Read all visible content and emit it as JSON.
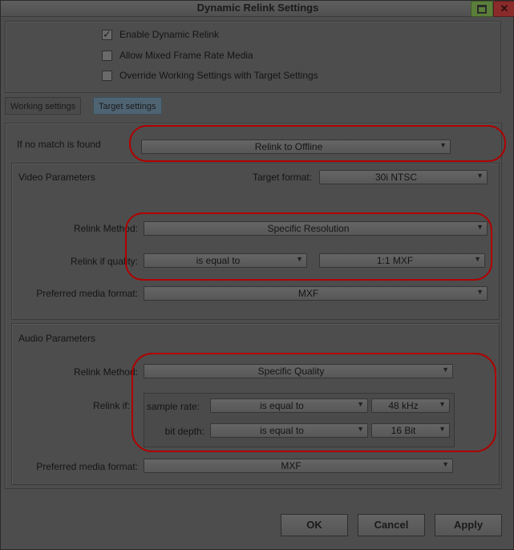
{
  "window": {
    "title": "Dynamic Relink Settings"
  },
  "options": {
    "enable_dynamic_relink": {
      "label": "Enable Dynamic Relink",
      "checked": true
    },
    "allow_mixed_frame_rate": {
      "label": "Allow Mixed Frame Rate Media",
      "checked": false
    },
    "override_working_settings": {
      "label": "Override Working Settings with Target Settings",
      "checked": false
    }
  },
  "tabs": {
    "working": "Working settings",
    "target": "Target settings",
    "active": "target"
  },
  "no_match": {
    "label": "If no match is found",
    "value": "Relink to Offline"
  },
  "video": {
    "title": "Video Parameters",
    "target_format_label": "Target format:",
    "target_format_value": "30i NTSC",
    "relink_method_label": "Relink Method:",
    "relink_method_value": "Specific Resolution",
    "relink_if_quality_label": "Relink if quality:",
    "quality_comparator": "is equal to",
    "quality_value": "1:1  MXF",
    "preferred_format_label": "Preferred media format:",
    "preferred_format_value": "MXF"
  },
  "audio": {
    "title": "Audio Parameters",
    "relink_method_label": "Relink Method:",
    "relink_method_value": "Specific Quality",
    "relink_if_label": "Relink if:",
    "sample_rate_label": "sample rate:",
    "sample_rate_comparator": "is equal to",
    "sample_rate_value": "48 kHz",
    "bit_depth_label": "bit depth:",
    "bit_depth_comparator": "is equal to",
    "bit_depth_value": "16 Bit",
    "preferred_format_label": "Preferred media format:",
    "preferred_format_value": "MXF"
  },
  "buttons": {
    "ok": "OK",
    "cancel": "Cancel",
    "apply": "Apply"
  },
  "icons": {
    "dropdown": "▼",
    "maximize": "maximize-icon",
    "close": "✕"
  },
  "colors": {
    "annotation": "#b00000",
    "active_tab": "#4f6473"
  }
}
